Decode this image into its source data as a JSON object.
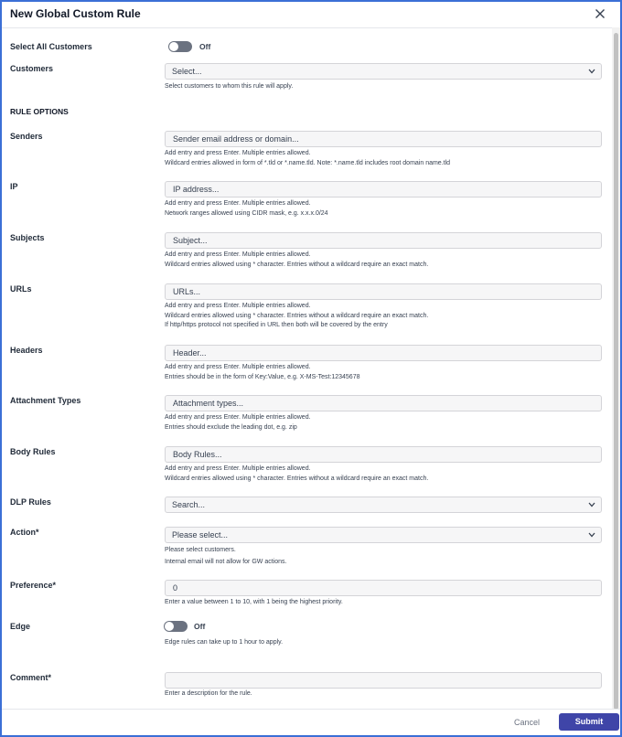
{
  "dialog": {
    "title": "New Global Custom Rule",
    "close_icon": "close-icon"
  },
  "select_all": {
    "label": "Select All Customers",
    "state": "Off"
  },
  "customers": {
    "label": "Customers",
    "value": "Select...",
    "help": [
      "Select customers to whom this rule will apply."
    ]
  },
  "rule_options": {
    "heading": "RULE OPTIONS"
  },
  "senders": {
    "label": "Senders",
    "placeholder": "Sender email address or domain...",
    "help": [
      "Add entry and press Enter. Multiple entries allowed.",
      "Wildcard entries allowed in form of *.tld or *.name.tld. Note: *.name.tld includes root domain name.tld"
    ]
  },
  "ip": {
    "label": "IP",
    "placeholder": "IP address...",
    "help": [
      "Add entry and press Enter. Multiple entries allowed.",
      "Network ranges allowed using CIDR mask, e.g. x.x.x.0/24"
    ]
  },
  "subjects": {
    "label": "Subjects",
    "placeholder": "Subject...",
    "help": [
      "Add entry and press Enter. Multiple entries allowed.",
      "Wildcard entries allowed using * character. Entries without a wildcard require an exact match."
    ]
  },
  "urls": {
    "label": "URLs",
    "placeholder": "URLs...",
    "help": [
      "Add entry and press Enter. Multiple entries allowed.",
      "Wildcard entries allowed using * character. Entries without a wildcard require an exact match.",
      "If http/https protocol not specified in URL then both will be covered by the entry"
    ]
  },
  "headers": {
    "label": "Headers",
    "placeholder": "Header...",
    "help": [
      "Add entry and press Enter. Multiple entries allowed.",
      "Entries should be in the form of Key:Value, e.g. X-MS-Test:12345678"
    ]
  },
  "attachment_types": {
    "label": "Attachment Types",
    "placeholder": "Attachment types...",
    "help": [
      "Add entry and press Enter. Multiple entries allowed.",
      "Entries should exclude the leading dot, e.g. zip"
    ]
  },
  "body_rules": {
    "label": "Body Rules",
    "placeholder": "Body Rules...",
    "help": [
      "Add entry and press Enter. Multiple entries allowed.",
      "Wildcard entries allowed using * character. Entries without a wildcard require an exact match."
    ]
  },
  "dlp_rules": {
    "label": "DLP Rules",
    "value": "Search..."
  },
  "action": {
    "label": "Action*",
    "value": "Please select...",
    "help": [
      "Please select customers.",
      "Internal email will not allow for GW actions."
    ]
  },
  "preference": {
    "label": "Preference*",
    "value": "0",
    "help": [
      "Enter a value between 1 to 10, with 1 being the highest priority."
    ]
  },
  "edge": {
    "label": "Edge",
    "state": "Off",
    "help": [
      "Edge rules can take up to 1 hour to apply."
    ]
  },
  "comment": {
    "label": "Comment*",
    "value": "",
    "help": [
      "Enter a description for the rule."
    ]
  },
  "footer": {
    "cancel_label": "Cancel",
    "submit_label": "Submit"
  },
  "colors": {
    "accent": "#3f45a8",
    "frame_border": "#3b6fd6",
    "toggle_off": "#6b7280"
  }
}
